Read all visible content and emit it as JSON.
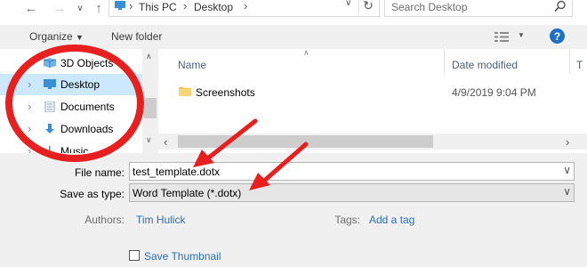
{
  "address_bar": {
    "crumbs": [
      "This PC",
      "Desktop"
    ],
    "search_placeholder": "Search Desktop"
  },
  "toolbar": {
    "organize_label": "Organize",
    "new_folder_label": "New folder"
  },
  "nav_pane": {
    "items": [
      {
        "label": "3D Objects",
        "selected": false
      },
      {
        "label": "Desktop",
        "selected": true
      },
      {
        "label": "Documents",
        "selected": false
      },
      {
        "label": "Downloads",
        "selected": false
      },
      {
        "label": "Music",
        "selected": false
      }
    ]
  },
  "file_list": {
    "columns": {
      "name": "Name",
      "date_modified": "Date modified",
      "type": "T"
    },
    "rows": [
      {
        "name": "Screenshots",
        "date_modified": "4/9/2019 9:04 PM"
      }
    ]
  },
  "form": {
    "file_name_label": "File name:",
    "file_name_value": "test_template.dotx",
    "save_type_label": "Save as type:",
    "save_type_value": "Word Template (*.dotx)",
    "authors_label": "Authors:",
    "authors_value": "Tim Hulick",
    "tags_label": "Tags:",
    "tags_value": "Add a tag",
    "save_thumbnail_label": "Save Thumbnail",
    "save_thumbnail_checked": false
  },
  "annotation_colors": {
    "highlight": "#e81f1f",
    "selection": "#cce8ff"
  }
}
